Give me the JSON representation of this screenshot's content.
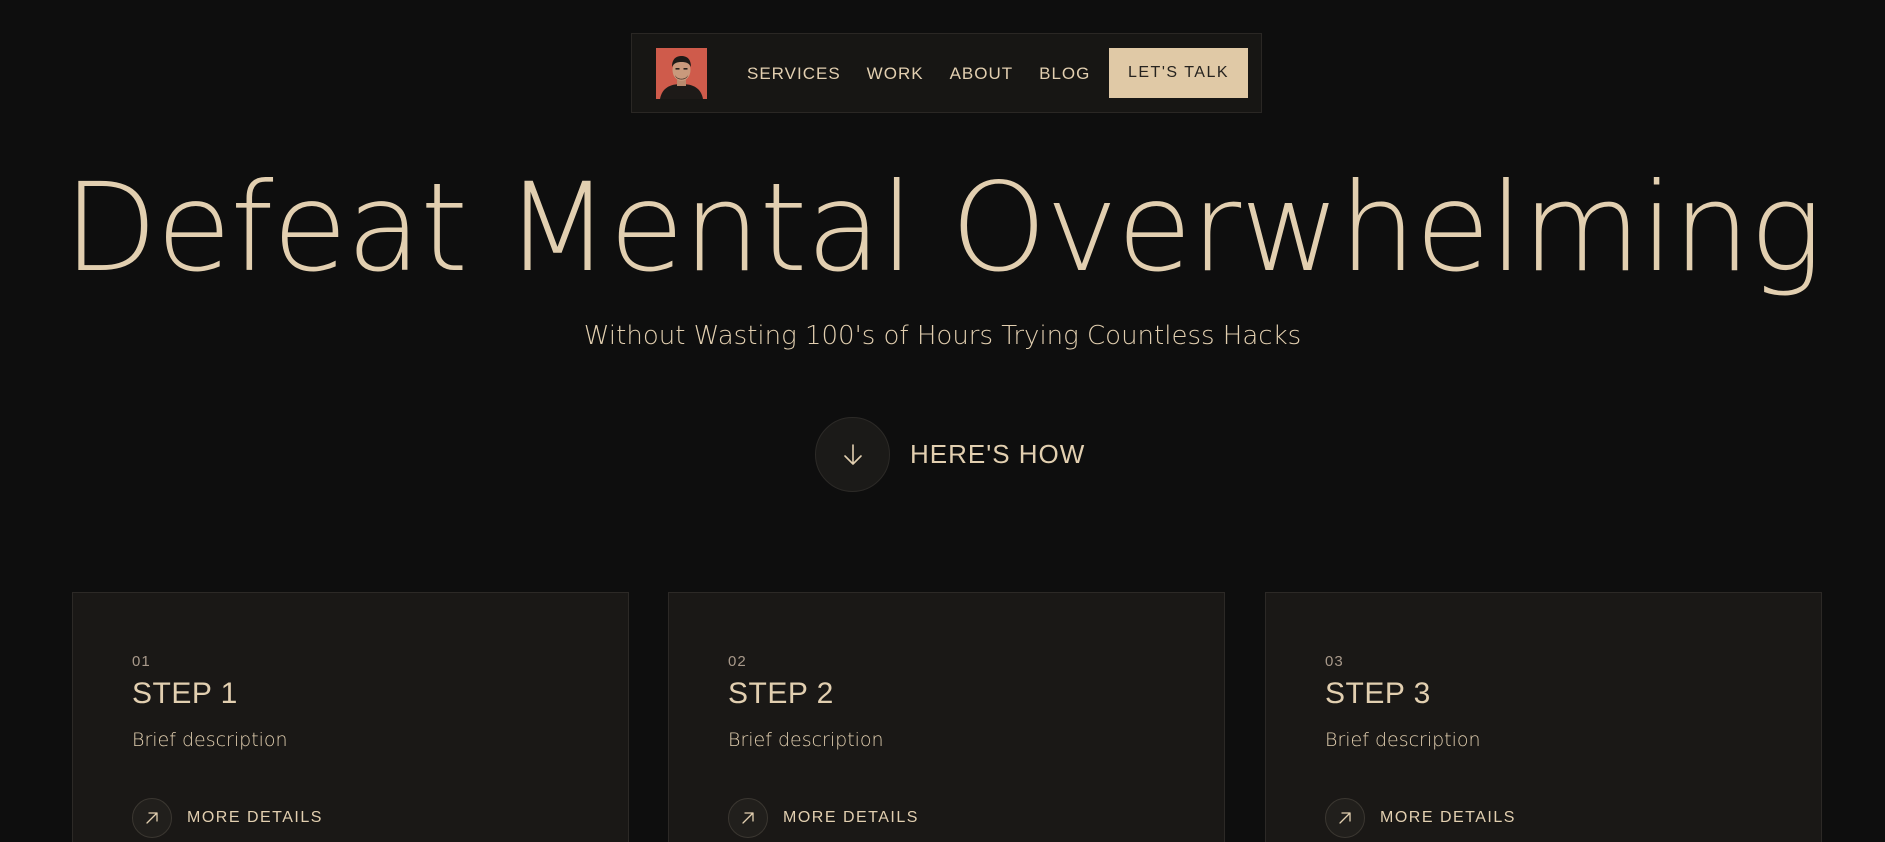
{
  "nav": {
    "avatar_alt": "",
    "links": [
      "SERVICES",
      "WORK",
      "ABOUT",
      "BLOG"
    ],
    "cta_label": "LET'S TALK"
  },
  "hero": {
    "title": "Defeat Mental Overwhelming",
    "subtitle": "Without Wasting 100's of Hours Trying Countless Hacks",
    "how_label": "HERE'S HOW",
    "how_icon": "arrow-down-icon"
  },
  "steps": [
    {
      "number": "01",
      "title": "STEP 1",
      "description": "Brief description",
      "more_label": "MORE DETAILS"
    },
    {
      "number": "02",
      "title": "STEP 2",
      "description": "Brief description",
      "more_label": "MORE DETAILS"
    },
    {
      "number": "03",
      "title": "STEP 3",
      "description": "Brief description",
      "more_label": "MORE DETAILS"
    }
  ],
  "colors": {
    "background": "#0e0e0e",
    "card": "#1a1816",
    "accent": "#e2cfb0",
    "button": "#e0c9a6",
    "avatar_bg": "#cf5b4b"
  }
}
